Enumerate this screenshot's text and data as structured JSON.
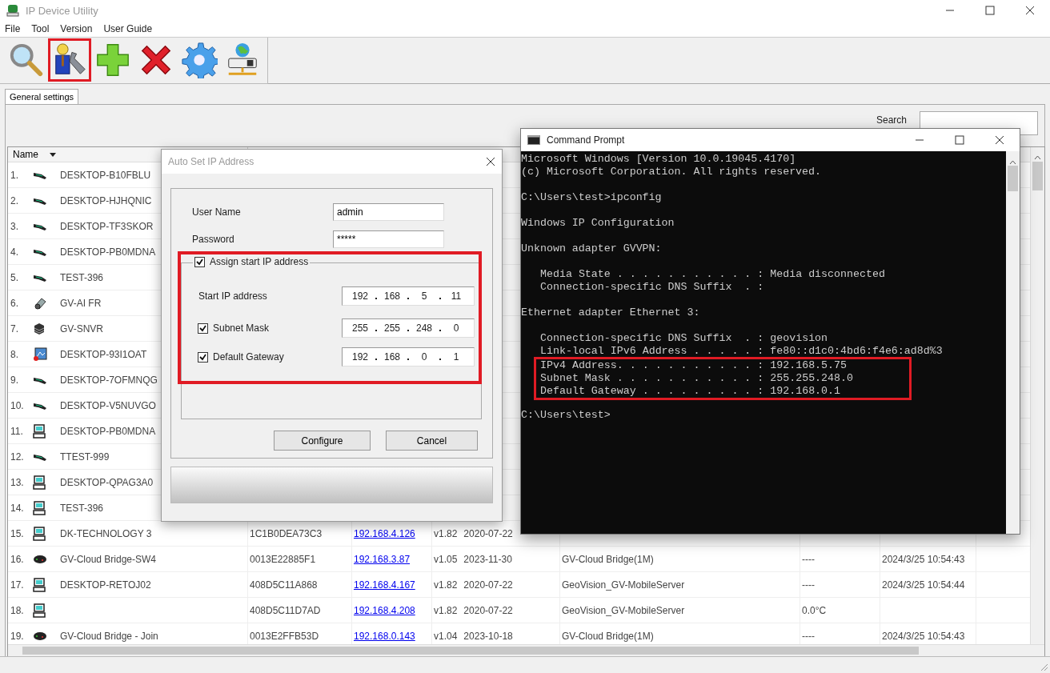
{
  "window": {
    "title": "IP Device Utility"
  },
  "menu": [
    "File",
    "Tool",
    "Version",
    "User Guide"
  ],
  "toolbar": [
    {
      "kind": "search",
      "highlighted": false
    },
    {
      "kind": "user-config",
      "highlighted": true
    },
    {
      "kind": "add",
      "highlighted": false
    },
    {
      "kind": "delete",
      "highlighted": false
    },
    {
      "kind": "settings",
      "highlighted": false
    },
    {
      "kind": "network",
      "highlighted": false
    }
  ],
  "tabs": [
    {
      "label": "General settings",
      "selected": true
    }
  ],
  "search": {
    "label": "Search"
  },
  "table": {
    "name_header": "Name",
    "rows": [
      {
        "index": "1.",
        "kind": "handheld",
        "name": "DESKTOP-B10FBLU"
      },
      {
        "index": "2.",
        "kind": "handheld",
        "name": "DESKTOP-HJHQNIC"
      },
      {
        "index": "3.",
        "kind": "handheld",
        "name": "DESKTOP-TF3SKOR"
      },
      {
        "index": "4.",
        "kind": "handheld",
        "name": "DESKTOP-PB0MDNA"
      },
      {
        "index": "5.",
        "kind": "handheld",
        "name": "TEST-396"
      },
      {
        "index": "6.",
        "kind": "camera",
        "name": "GV-AI FR"
      },
      {
        "index": "7.",
        "kind": "nvr",
        "name": "GV-SNVR"
      },
      {
        "index": "8.",
        "kind": "video",
        "name": "DESKTOP-93I1OAT"
      },
      {
        "index": "9.",
        "kind": "handheld",
        "name": "DESKTOP-7OFMNQG"
      },
      {
        "index": "10.",
        "kind": "handheld",
        "name": "DESKTOP-V5NUVGO"
      },
      {
        "index": "11.",
        "kind": "computer",
        "name": "DESKTOP-PB0MDNA"
      },
      {
        "index": "12.",
        "kind": "handheld",
        "name": "TTEST-999"
      },
      {
        "index": "13.",
        "kind": "computer",
        "name": "DESKTOP-QPAG3A0"
      },
      {
        "index": "14.",
        "kind": "computer",
        "name": "TEST-396"
      },
      {
        "index": "15.",
        "kind": "computer",
        "name": "DK-TECHNOLOGY 3",
        "mac": "1C1B0DEA73C3",
        "ip": "192.168.4.126",
        "version": "v1.82",
        "date": "2020-07-22"
      },
      {
        "index": "16.",
        "kind": "bridge",
        "name": "GV-Cloud Bridge-SW4",
        "mac": "0013E22885F1",
        "ip": "192.168.3.87",
        "version": "v1.05",
        "date": "2023-11-30",
        "model": "GV-Cloud Bridge(1M)",
        "temperature": "----",
        "time": "2024/3/25 10:54:43"
      },
      {
        "index": "17.",
        "kind": "computer",
        "name": "DESKTOP-RETOJ02",
        "mac": "408D5C11A868",
        "ip": "192.168.4.167",
        "version": "v1.82",
        "date": "2020-07-22",
        "model": "GeoVision_GV-MobileServer",
        "temperature": "----",
        "time": "2024/3/25 10:54:44"
      },
      {
        "index": "18.",
        "kind": "computer",
        "mac": "408D5C11D7AD",
        "ip": "192.168.4.208",
        "version": "v1.82",
        "date": "2020-07-22",
        "model": "GeoVision_GV-MobileServer",
        "temperature": "0.0°C"
      },
      {
        "index": "19.",
        "kind": "bridge",
        "name": "GV-Cloud Bridge - Join",
        "mac": "0013E2FFB53D",
        "ip": "192.168.0.143",
        "version": "v1.04",
        "date": "2023-10-18",
        "model": "GV-Cloud Bridge(1M)",
        "temperature": "----",
        "time": "2024/3/25 10:54:43"
      }
    ]
  },
  "dialog": {
    "title": "Auto Set IP Address",
    "user_name": {
      "label": "User Name",
      "value": "admin"
    },
    "password": {
      "label": "Password",
      "value": "*****"
    },
    "assign": {
      "label": "Assign start IP address",
      "checked": true,
      "highlighted": true
    },
    "start_ip": {
      "label": "Start IP address",
      "octets": [
        "192",
        "168",
        "5",
        "11"
      ]
    },
    "subnet": {
      "label": "Subnet Mask",
      "checked": true,
      "octets": [
        "255",
        "255",
        "248",
        "0"
      ]
    },
    "gateway": {
      "label": "Default Gateway",
      "checked": true,
      "octets": [
        "192",
        "168",
        "0",
        "1"
      ]
    },
    "buttons": [
      "Configure",
      "Cancel"
    ]
  },
  "console": {
    "title": "Command Prompt",
    "blocks": [
      {
        "kind": "banner",
        "highlighted": false,
        "lines": [
          "Microsoft Windows [Version 10.0.19045.4170]",
          "(c) Microsoft Corporation. All rights reserved."
        ]
      },
      {
        "kind": "prompt",
        "highlighted": false,
        "lines": [
          "C:\\Users\\test>ipconfig"
        ]
      },
      {
        "kind": "heading",
        "highlighted": false,
        "lines": [
          "Windows IP Configuration"
        ]
      },
      {
        "kind": "adapter",
        "highlighted": false,
        "lines": [
          "Unknown adapter GVVPN:"
        ]
      },
      {
        "kind": "properties",
        "highlighted": false,
        "lines": [
          "Media State . . . . . . . . . . . : Media disconnected",
          "Connection-specific DNS Suffix  . :"
        ]
      },
      {
        "kind": "adapter",
        "highlighted": false,
        "lines": [
          "Ethernet adapter Ethernet 3:"
        ]
      },
      {
        "kind": "properties",
        "highlighted": false,
        "lines": [
          "Connection-specific DNS Suffix  . : geovision",
          "Link-local IPv6 Address . . . . . : fe80::d1c0:4bd6:f4e6:ad8d%3"
        ]
      },
      {
        "kind": "more_properties",
        "highlighted": true,
        "lines": [
          "IPv4 Address. . . . . . . . . . . : 192.168.5.75",
          "Subnet Mask . . . . . . . . . . . : 255.255.248.0",
          "Default Gateway . . . . . . . . . : 192.168.0.1"
        ]
      },
      {
        "kind": "prompt",
        "highlighted": false,
        "lines": [
          "C:\\Users\\test>"
        ]
      }
    ]
  }
}
